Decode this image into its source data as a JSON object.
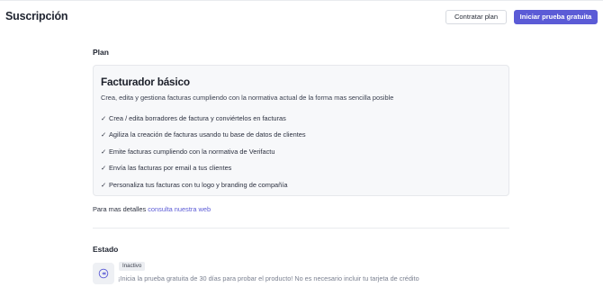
{
  "header": {
    "title": "Suscripción",
    "secondary_button": "Contratar plan",
    "primary_button": "Iniciar prueba gratuita"
  },
  "plan_section": {
    "label": "Plan",
    "card": {
      "name": "Facturador básico",
      "description": "Crea, edita y gestiona facturas cumpliendo con la normativa actual de la forma mas sencilla posible",
      "check_glyph": "✓",
      "features": [
        "Crea / edita borradores de factura y conviértelos en facturas",
        "Agiliza la creación de facturas usando tu base de datos de clientes",
        "Emite facturas cumpliendo con la normativa de Verifactu",
        "Envía las facturas por email a tus clientes",
        "Personaliza tus facturas con tu logo y branding de compañía"
      ]
    },
    "details_text": "Para mas detalles",
    "details_link": "consulta nuestra web"
  },
  "status_section": {
    "label": "Estado",
    "icon": "rewind-circle-icon",
    "badge": "Inactivo",
    "message": "¡Inicia la prueba gratuita de 30 días para probar el producto! No es necesario incluir tu tarjeta de crédito"
  },
  "colors": {
    "accent": "#5b5bd6",
    "card_bg": "#f7f8fa"
  }
}
